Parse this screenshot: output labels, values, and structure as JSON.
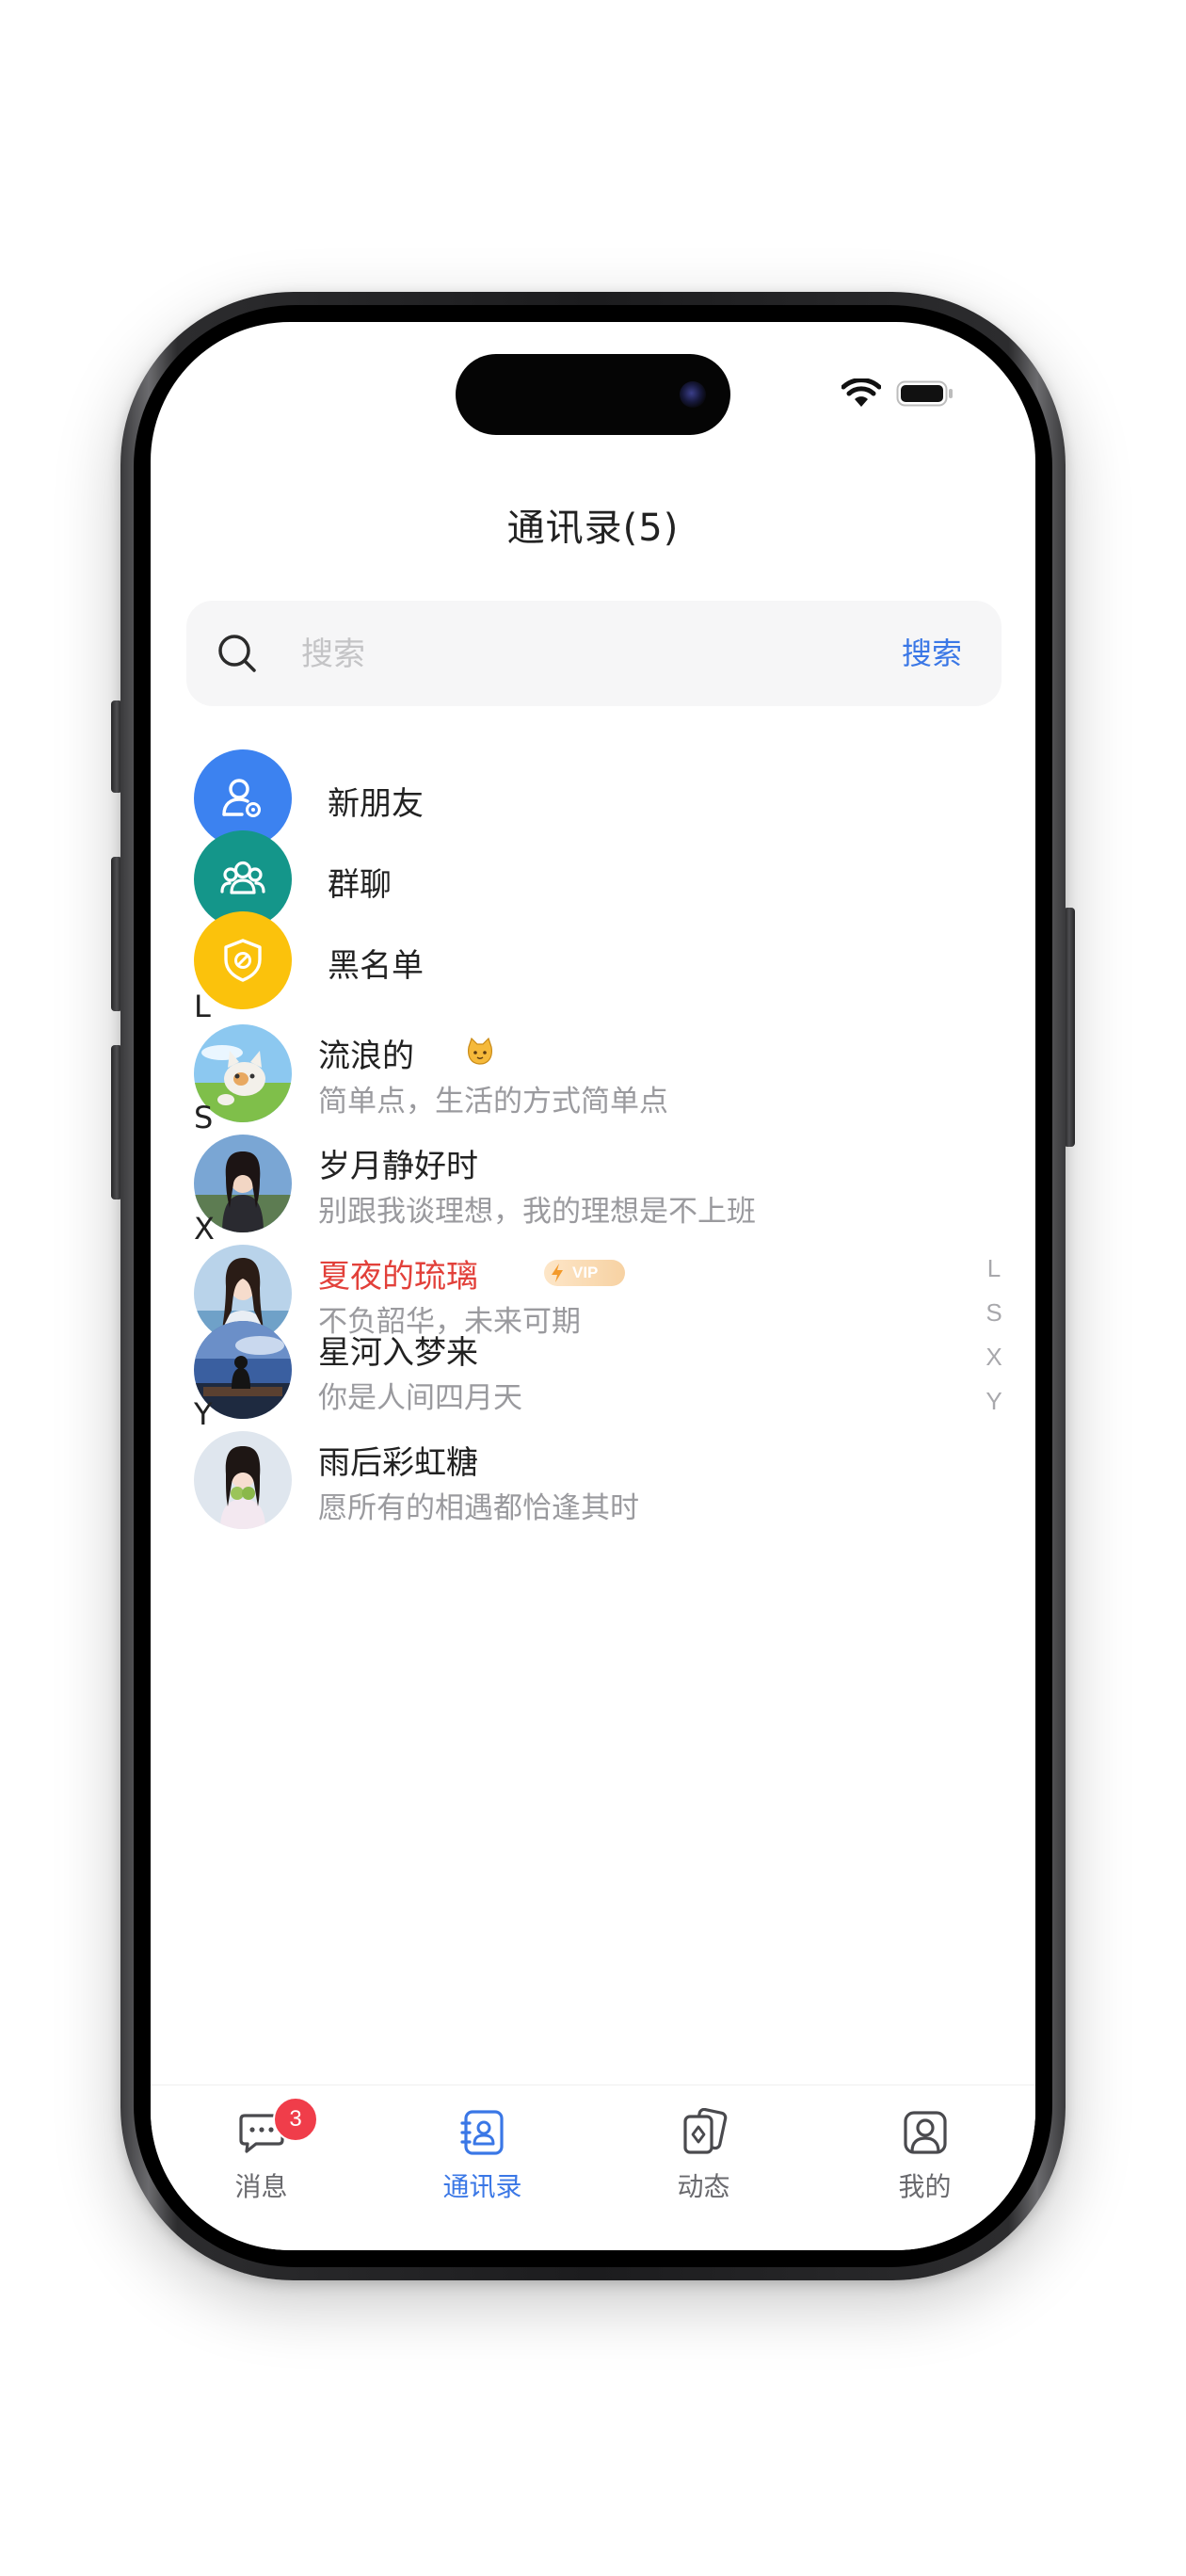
{
  "header": {
    "title": "通讯录(5)"
  },
  "search": {
    "placeholder": "搜索",
    "button_label": "搜索"
  },
  "functions": [
    {
      "label": "新朋友",
      "icon": "add-friend-icon",
      "color": "#3c82f0"
    },
    {
      "label": "群聊",
      "icon": "group-icon",
      "color": "#14968a"
    },
    {
      "label": "黑名单",
      "icon": "blocked-shield-icon",
      "color": "#fbc20c"
    }
  ],
  "sections": [
    {
      "letter": "L",
      "contacts": [
        {
          "name": "流浪的",
          "emoji": "cat-face-icon",
          "signature": "简单点，生活的方式简单点"
        }
      ]
    },
    {
      "letter": "S",
      "contacts": [
        {
          "name": "岁月静好时",
          "signature": "别跟我谈理想，我的理想是不上班"
        }
      ]
    },
    {
      "letter": "X",
      "contacts": [
        {
          "name": "夏夜的琉璃",
          "vip": true,
          "vip_label": "VIP",
          "signature": "不负韶华，未来可期"
        },
        {
          "name": "星河入梦来",
          "signature": "你是人间四月天"
        }
      ]
    },
    {
      "letter": "Y",
      "contacts": [
        {
          "name": "雨后彩虹糖",
          "signature": "愿所有的相遇都恰逢其时"
        }
      ]
    }
  ],
  "index_letters": [
    "L",
    "S",
    "X",
    "Y"
  ],
  "tabs": [
    {
      "label": "消息",
      "icon": "chat-bubble-icon",
      "badge": "3"
    },
    {
      "label": "通讯录",
      "icon": "contacts-book-icon",
      "active": true
    },
    {
      "label": "动态",
      "icon": "cards-icon"
    },
    {
      "label": "我的",
      "icon": "profile-icon"
    }
  ],
  "colors": {
    "accent": "#3a77e6",
    "vip_name": "#e2403a",
    "badge": "#f03d4a"
  }
}
